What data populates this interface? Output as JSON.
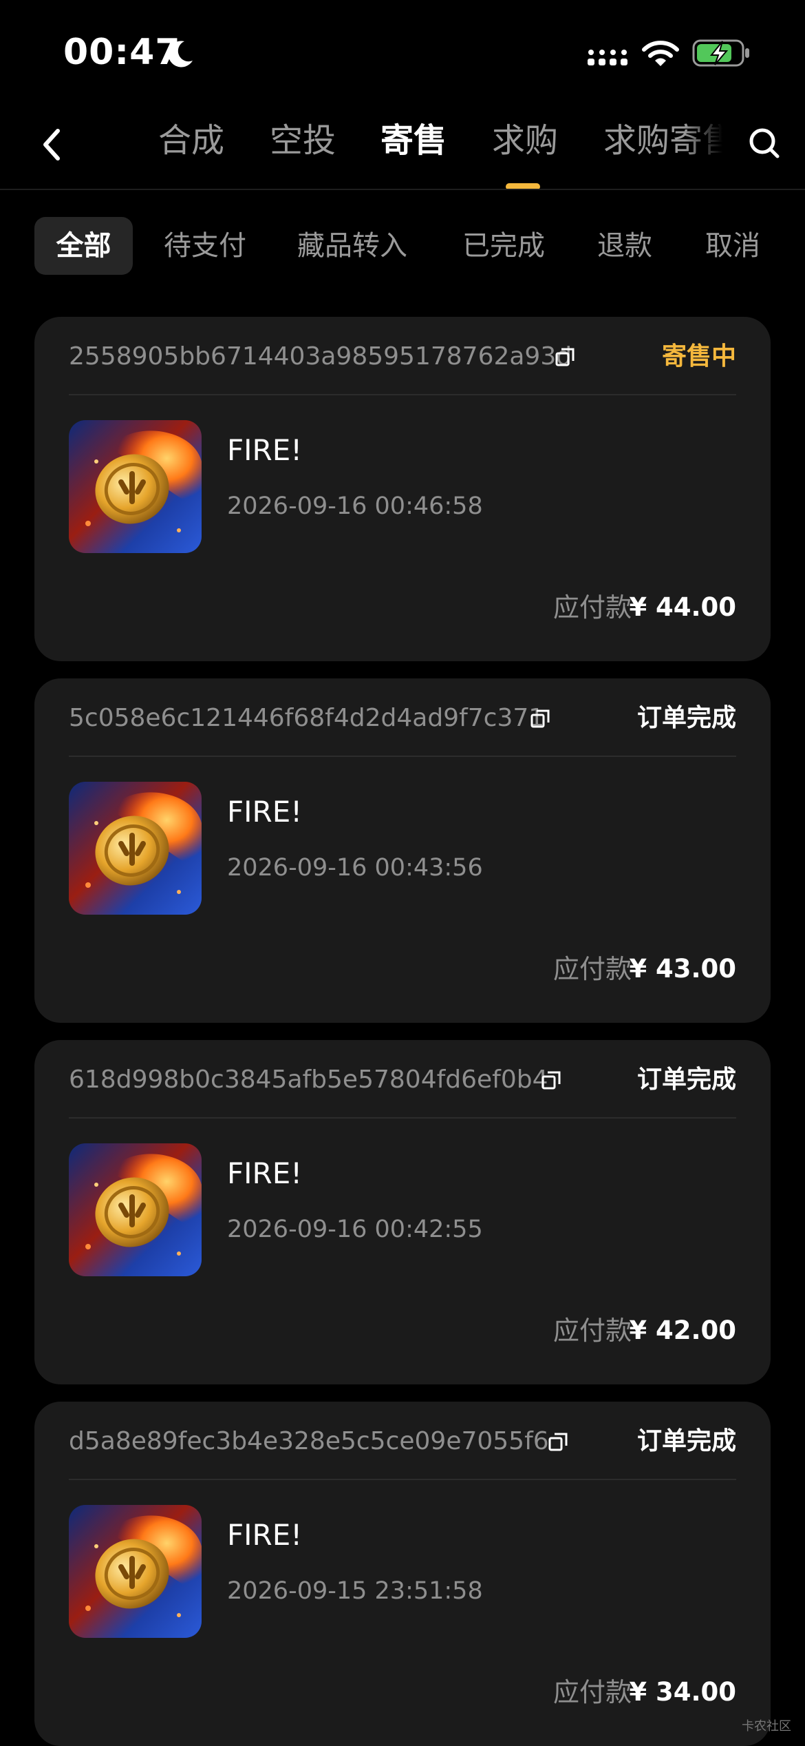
{
  "status_bar": {
    "time": "00:47",
    "icons": [
      "moon-icon",
      "signal-icon",
      "wifi-icon",
      "battery-charging-icon"
    ]
  },
  "top_nav": {
    "back_icon": "chevron-left-icon",
    "search_icon": "search-icon",
    "tabs": [
      {
        "label": "合成"
      },
      {
        "label": "空投"
      },
      {
        "label": "寄售"
      },
      {
        "label": "求购"
      },
      {
        "label": "求购寄售"
      }
    ],
    "active_tab": "寄售",
    "accent_color": "#f5b83d"
  },
  "filters": [
    {
      "label": "全部"
    },
    {
      "label": "待支付"
    },
    {
      "label": "藏品转入"
    },
    {
      "label": "已完成"
    },
    {
      "label": "退款"
    },
    {
      "label": "取消"
    }
  ],
  "active_filter": "全部",
  "orders": [
    {
      "id": "2558905bb6714403a98595178762a93d",
      "status": "寄售中",
      "product_name": "FIRE!",
      "time": "2026-09-16 00:46:58",
      "pay_label": "应付款",
      "amount": "¥ 44.00"
    },
    {
      "id": "5c058e6c121446f68f4d2d4ad9f7c371",
      "status": "订单完成",
      "product_name": "FIRE!",
      "time": "2026-09-16 00:43:56",
      "pay_label": "应付款",
      "amount": "¥ 43.00"
    },
    {
      "id": "618d998b0c3845afb5e57804fd6ef0b4",
      "status": "订单完成",
      "product_name": "FIRE!",
      "time": "2026-09-16 00:42:55",
      "pay_label": "应付款",
      "amount": "¥ 42.00"
    },
    {
      "id": "d5a8e89fec3b4e328e5c5ce09e7055f6",
      "status": "订单完成",
      "product_name": "FIRE!",
      "time": "2026-09-15 23:51:58",
      "pay_label": "应付款",
      "amount": "¥ 34.00"
    }
  ],
  "status_colors": {
    "寄售中": "#f5b83d",
    "订单完成": "#ffffff"
  },
  "watermark": "卡农社区"
}
